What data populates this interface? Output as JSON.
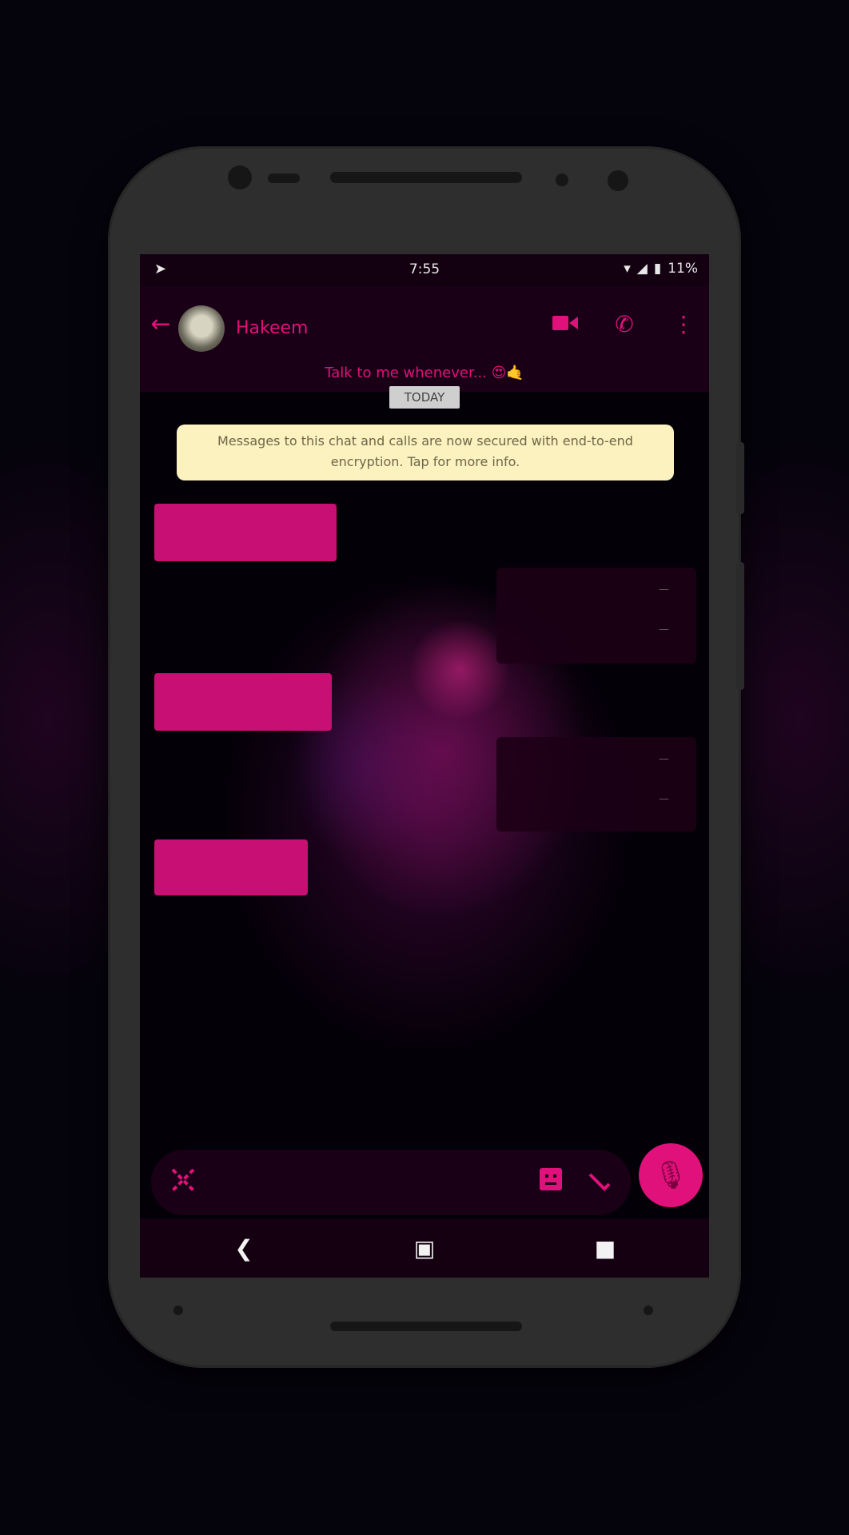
{
  "status_bar": {
    "left_icon": "navigation-arrow-icon",
    "time": "7:55",
    "right_icons": [
      "wifi-icon",
      "signal-icon",
      "battery-icon"
    ],
    "battery_text": "11%"
  },
  "header": {
    "back_icon": "back-arrow-icon",
    "contact_name": "Hakeem",
    "actions": [
      "video-call-icon",
      "phone-call-icon",
      "more-vert-icon"
    ],
    "status_text": "Talk to me whenever... 😍🤙"
  },
  "chat": {
    "date_chip": "TODAY",
    "notice_line1": "Messages to this chat and calls are now secured with end-to-end",
    "notice_line2": "encryption. Tap for more info."
  },
  "composer": {
    "emoji_icon": "emoji-icon",
    "sticker_icon": "sticker-icon",
    "attach_icon": "attach-icon",
    "mic_icon": "mic-icon"
  },
  "navigation": [
    "back-nav-icon",
    "home-nav-icon",
    "recents-nav-icon"
  ],
  "colors": {
    "accent": "#e0117a",
    "incoming_bubble": "#c80f74",
    "notice_bg": "#fbf2c0"
  }
}
